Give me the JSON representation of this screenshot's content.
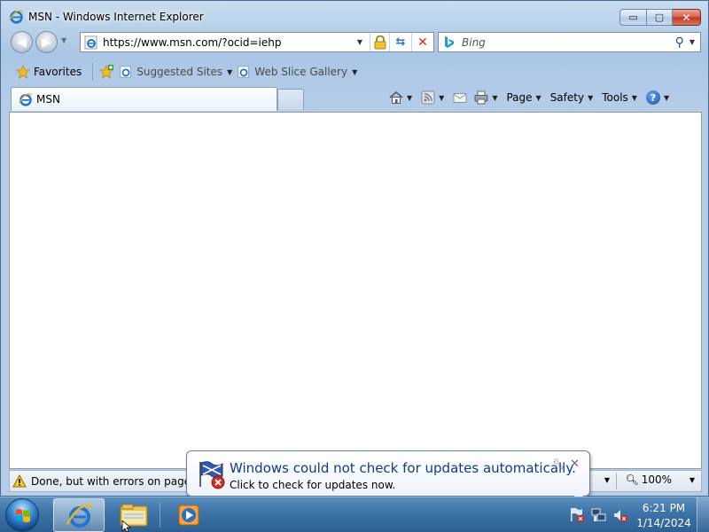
{
  "window": {
    "title": "MSN - Windows Internet Explorer",
    "caption": {
      "minimize": "▭",
      "maximize": "▢",
      "close": "✕"
    }
  },
  "address": {
    "url": "https://www.msn.com/?ocid=iehp"
  },
  "search": {
    "placeholder": "Bing"
  },
  "favorites_bar": {
    "favorites_label": "Favorites",
    "items": [
      {
        "label": "Suggested Sites"
      },
      {
        "label": "Web Slice Gallery"
      }
    ]
  },
  "tabs": [
    {
      "label": "MSN"
    }
  ],
  "command_bar": {
    "page_label": "Page",
    "safety_label": "Safety",
    "tools_label": "Tools",
    "help_glyph": "?"
  },
  "status": {
    "text": "Done, but with errors on page.",
    "zoom": "100%"
  },
  "balloon": {
    "title": "Windows could not check for updates automatically.",
    "subtitle": "Click to check for updates now."
  },
  "clock": {
    "time": "6:21 PM",
    "date": "1/14/2024"
  },
  "colors": {
    "taskbar": "#3f75a9",
    "balloon_title": "#0b3d91",
    "close_red": "#c2321c"
  }
}
